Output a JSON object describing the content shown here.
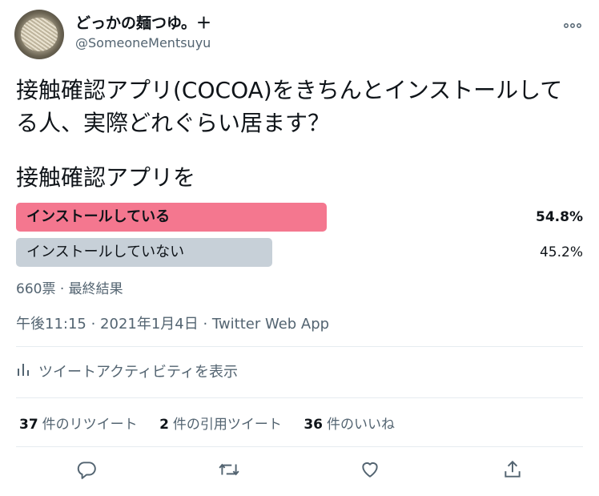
{
  "user": {
    "display_name": "どっかの麺つゆ。＋",
    "handle": "@SomeoneMentsuyu"
  },
  "tweet": {
    "text": "接触確認アプリ(COCOA)をきちんとインストールしてる人、実際どれぐらい居ます？"
  },
  "poll": {
    "question": "接触確認アプリを",
    "options": [
      {
        "label": "インストールしている",
        "percent_text": "54.8%",
        "percent": 54.8,
        "winner": true
      },
      {
        "label": "インストールしていない",
        "percent_text": "45.2%",
        "percent": 45.2,
        "winner": false
      }
    ],
    "meta": "660票 · 最終結果"
  },
  "timestamp": "午後11:15 · 2021年1月4日 · Twitter Web App",
  "activity_label": "ツイートアクティビティを表示",
  "stats": [
    {
      "count": "37",
      "label": "件のリツイート"
    },
    {
      "count": "2",
      "label": "件の引用ツイート"
    },
    {
      "count": "36",
      "label": "件のいいね"
    }
  ],
  "colors": {
    "winner_bar": "#f4778f",
    "loser_bar": "#c7d0d8",
    "secondary_text": "#536471"
  },
  "icons": [
    "more-icon",
    "analytics-icon",
    "reply-icon",
    "retweet-icon",
    "like-icon",
    "share-icon"
  ]
}
